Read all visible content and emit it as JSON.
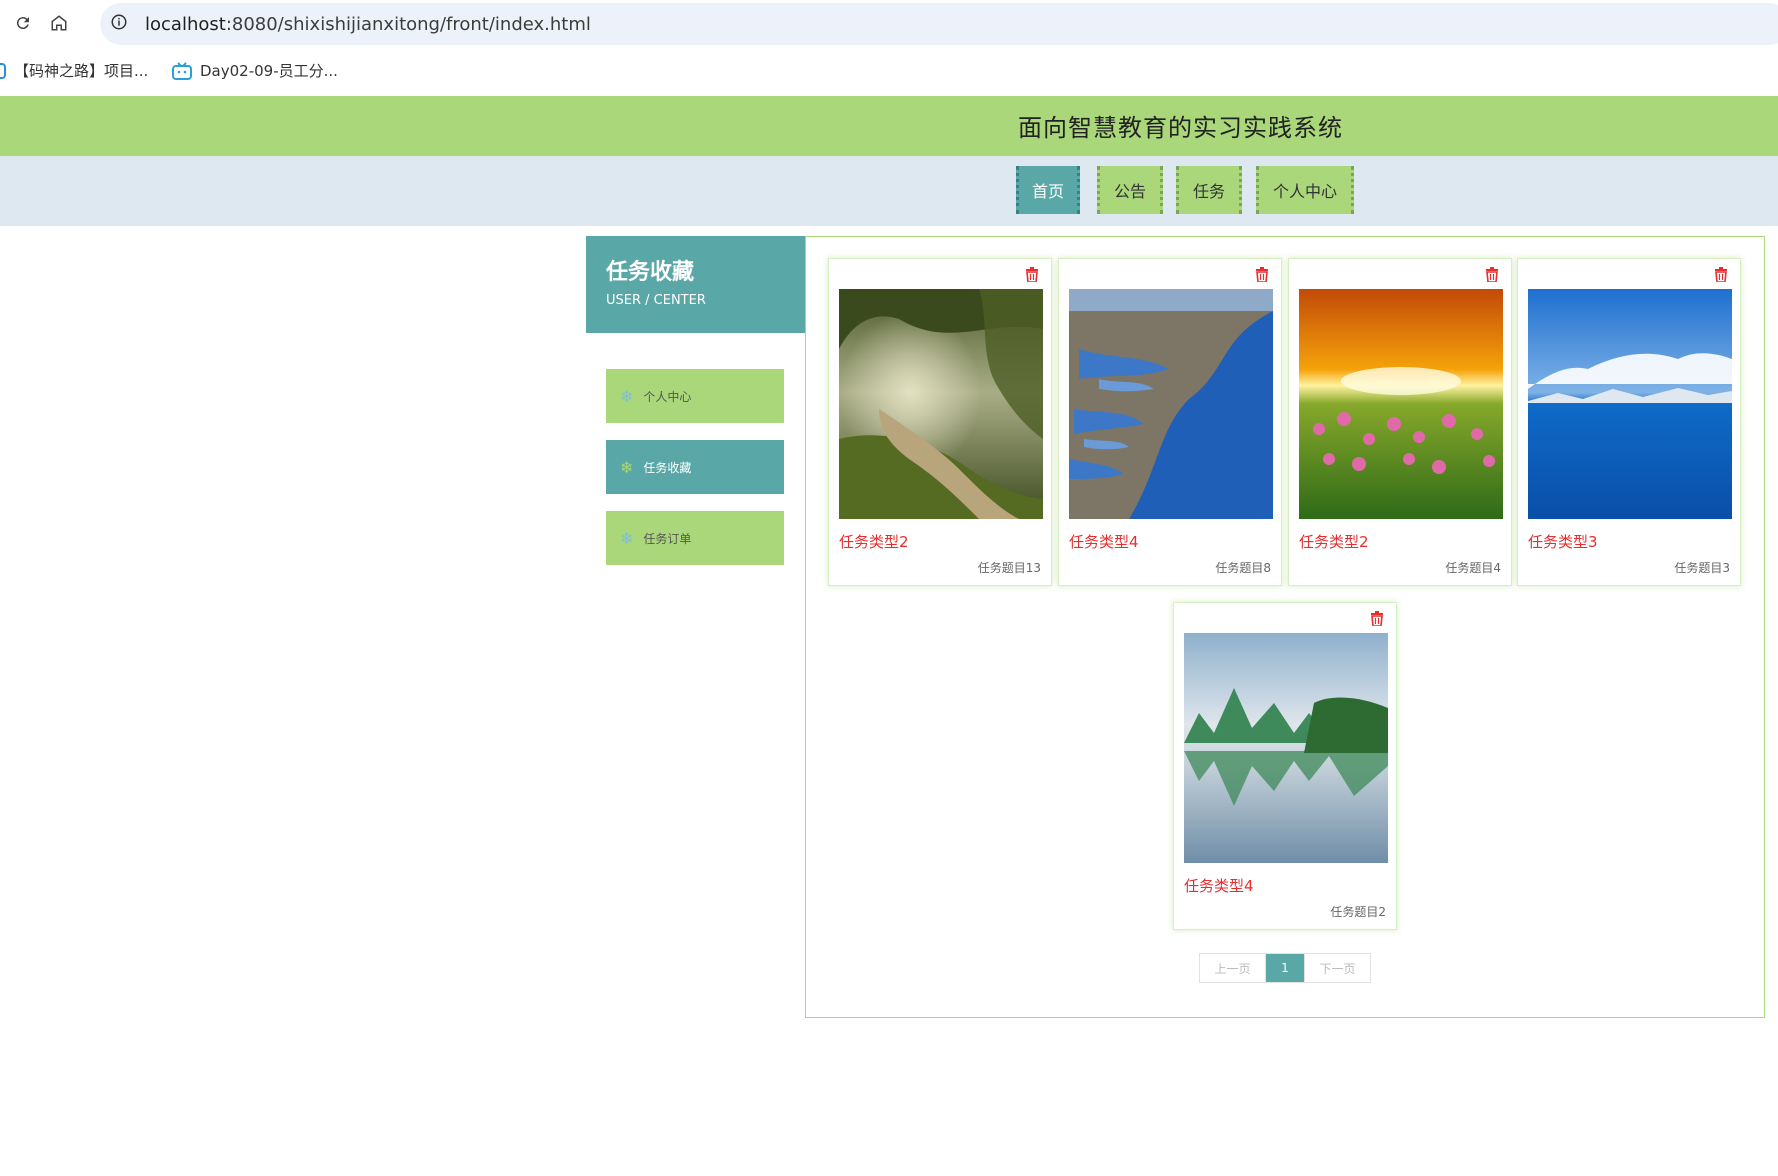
{
  "browser": {
    "url_host": "localhost",
    "url_rest": ":8080/shixishijianxitong/front/index.html",
    "bookmarks": [
      {
        "label": "【码神之路】项目..."
      },
      {
        "label": "Day02-09-员工分..."
      }
    ]
  },
  "site": {
    "title": "面向智慧教育的实习实践系统",
    "nav": [
      {
        "label": "首页",
        "active": true
      },
      {
        "label": "公告",
        "active": false
      },
      {
        "label": "任务",
        "active": false
      },
      {
        "label": "个人中心",
        "active": false
      }
    ]
  },
  "sidebar": {
    "title": "任务收藏",
    "subtitle": "USER / CENTER",
    "items": [
      {
        "label": "个人中心",
        "active": false
      },
      {
        "label": "任务收藏",
        "active": true
      },
      {
        "label": "任务订单",
        "active": false
      }
    ]
  },
  "cards": [
    {
      "type": "任务类型2",
      "topic": "任务题目13",
      "image": "forest-path"
    },
    {
      "type": "任务类型4",
      "topic": "任务题目8",
      "image": "coastline-aerial"
    },
    {
      "type": "任务类型2",
      "topic": "任务题目4",
      "image": "sunset-flowers"
    },
    {
      "type": "任务类型3",
      "topic": "任务题目3",
      "image": "lake-mountains"
    },
    {
      "type": "任务类型4",
      "topic": "任务题目2",
      "image": "karst-reflection"
    }
  ],
  "pager": {
    "prev": "上一页",
    "current": "1",
    "next": "下一页"
  },
  "colors": {
    "green": "#a9d77a",
    "teal": "#5aa7a7",
    "red": "#e82e2e"
  }
}
